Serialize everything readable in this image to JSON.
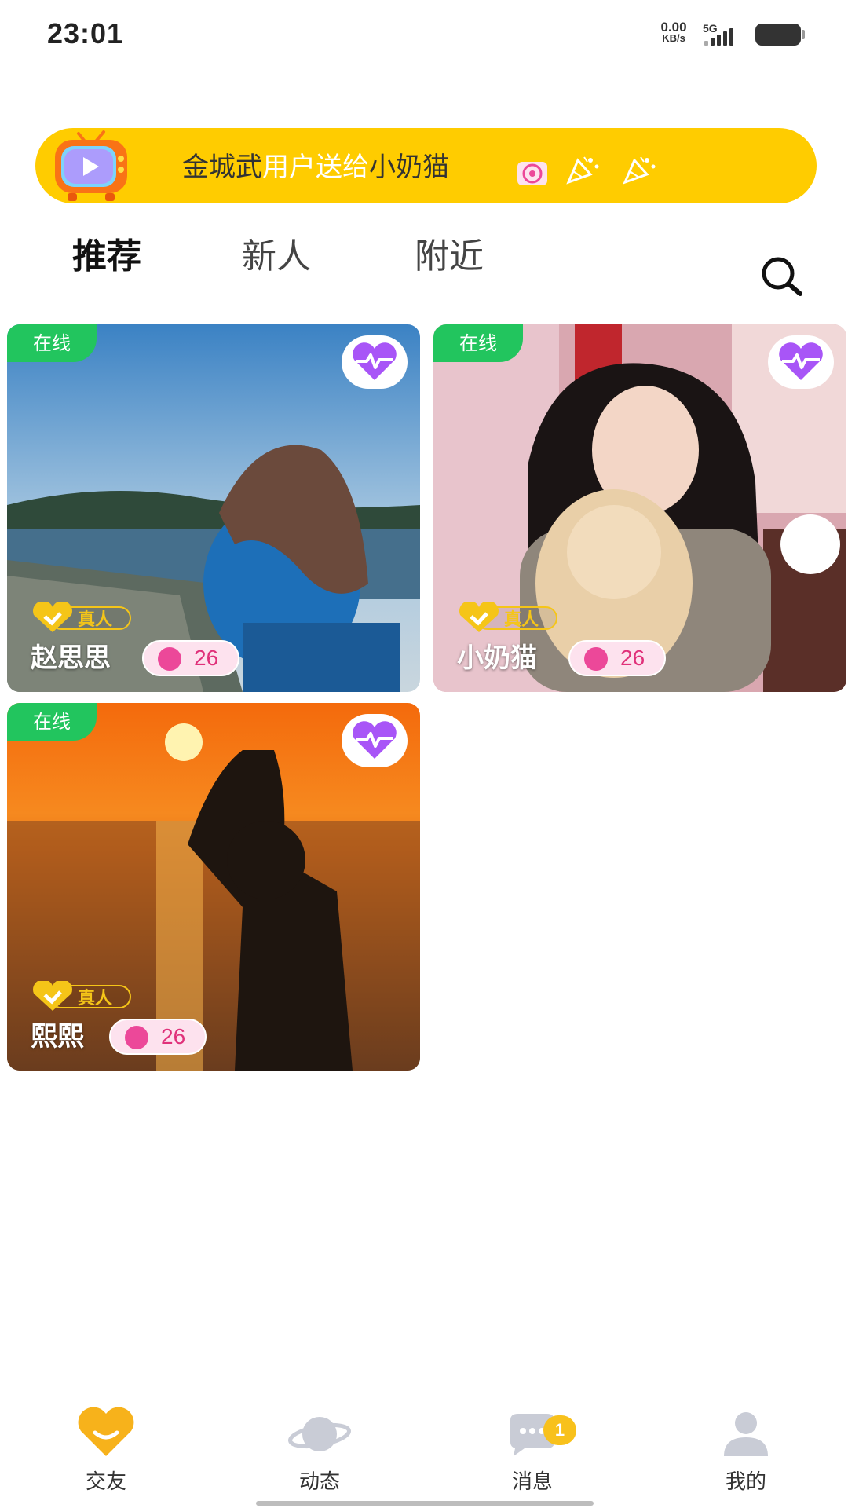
{
  "status_bar": {
    "time": "23:01",
    "net_speed_value": "0.00",
    "net_speed_unit": "KB/s",
    "network": "5G",
    "signal_icon": "signal-icon",
    "battery_icon": "battery-icon"
  },
  "banner": {
    "sender": "金城武",
    "mid": "用户送给",
    "receiver": "小奶猫",
    "icons": [
      "tv-icon",
      "gift-icon",
      "party-popper-icon",
      "party-popper-icon"
    ],
    "color": "#ffcc00"
  },
  "tabs": [
    {
      "label": "推荐",
      "active": true
    },
    {
      "label": "新人",
      "active": false
    },
    {
      "label": "附近",
      "active": false
    }
  ],
  "search_icon": "search-icon",
  "cards": [
    {
      "status": "在线",
      "verified_label": "真人",
      "name": "赵思思",
      "age": "26"
    },
    {
      "status": "在线",
      "verified_label": "真人",
      "name": "小奶猫",
      "age": "26"
    },
    {
      "status": "在线",
      "verified_label": "真人",
      "name": "熙熙",
      "age": "26"
    }
  ],
  "bottom_nav": [
    {
      "label": "交友",
      "icon": "heart-icon",
      "active": true
    },
    {
      "label": "动态",
      "icon": "planet-icon",
      "active": false
    },
    {
      "label": "消息",
      "icon": "chat-icon",
      "active": false,
      "badge": "1"
    },
    {
      "label": "我的",
      "icon": "user-icon",
      "active": false
    }
  ],
  "colors": {
    "online": "#22c55e",
    "accent_yellow": "#ffcc00",
    "like_purple": "#a855f7",
    "age_pink": "#ec4899"
  }
}
